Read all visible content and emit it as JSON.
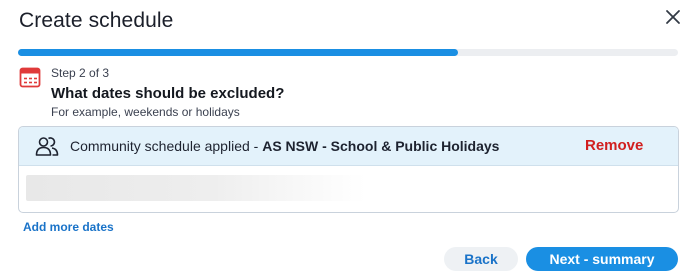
{
  "dialog": {
    "title": "Create schedule"
  },
  "progress": {
    "fraction": 0.667
  },
  "step": {
    "label": "Step 2 of 3",
    "question": "What dates should be excluded?",
    "hint": "For example, weekends or holidays"
  },
  "card": {
    "applied_prefix": "Community schedule applied",
    "applied_separator": " - ",
    "applied_name": "AS NSW - School & Public Holidays",
    "remove_label": "Remove"
  },
  "actions": {
    "add_more_label": "Add more dates",
    "back_label": "Back",
    "next_label": "Next - summary"
  },
  "colors": {
    "accent": "#1a8fe3",
    "link": "#1a73c8",
    "danger": "#d11f1f",
    "card_header": "#e3f2fb",
    "calendar_icon": "#e03a3a"
  },
  "icons": {
    "close": "close-icon",
    "calendar": "calendar-icon",
    "community": "people-icon"
  }
}
